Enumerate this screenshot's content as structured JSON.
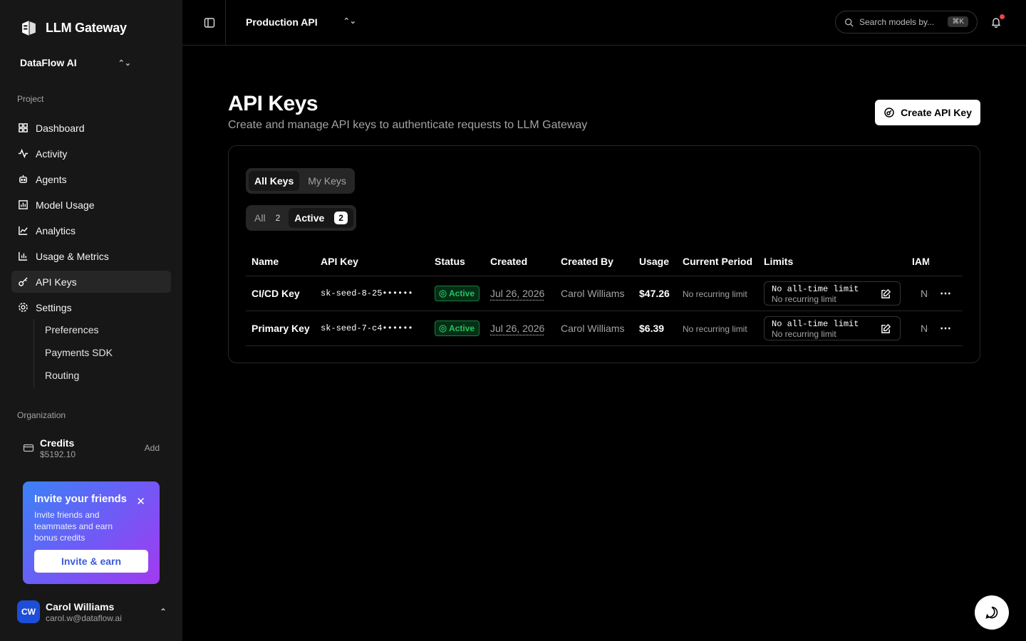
{
  "app": {
    "name": "LLM Gateway",
    "org": "DataFlow AI"
  },
  "sidebar": {
    "project_label": "Project",
    "items": [
      {
        "label": "Dashboard",
        "icon": "dashboard-icon"
      },
      {
        "label": "Activity",
        "icon": "activity-icon"
      },
      {
        "label": "Agents",
        "icon": "bot-icon"
      },
      {
        "label": "Model Usage",
        "icon": "bar-chart-icon"
      },
      {
        "label": "Analytics",
        "icon": "line-chart-icon"
      },
      {
        "label": "Usage & Metrics",
        "icon": "bar-chart-icon"
      },
      {
        "label": "API Keys",
        "icon": "key-icon",
        "active": true
      },
      {
        "label": "Settings",
        "icon": "gear-icon"
      }
    ],
    "sub_items": [
      "Preferences",
      "Payments SDK",
      "Routing"
    ],
    "org_label": "Organization",
    "credits": {
      "label": "Credits",
      "value": "$5192.10",
      "action": "Add"
    },
    "invite": {
      "title": "Invite your friends",
      "desc": "Invite friends and teammates and earn bonus credits",
      "button": "Invite & earn"
    },
    "user": {
      "initials": "CW",
      "name": "Carol Williams",
      "email": "carol.w@dataflow.ai"
    }
  },
  "topbar": {
    "project": "Production API",
    "search_placeholder": "Search models by...",
    "shortcut": "⌘K"
  },
  "main": {
    "title": "API Keys",
    "subtitle": "Create and manage API keys to authenticate requests to LLM Gateway",
    "create_button": "Create API Key",
    "tabs": [
      "All Keys",
      "My Keys"
    ],
    "filters": [
      {
        "label": "All",
        "count": "2"
      },
      {
        "label": "Active",
        "count": "2"
      }
    ],
    "columns": [
      "Name",
      "API Key",
      "Status",
      "Created",
      "Created By",
      "Usage",
      "Current Period",
      "Limits",
      "IAM"
    ],
    "rows": [
      {
        "name": "CI/CD Key",
        "key": "sk-seed-8-25••••••",
        "status": "Active",
        "created": "Jul 26, 2026",
        "created_by": "Carol Williams",
        "usage": "$47.26",
        "period": "No recurring limit",
        "limit1": "No all-time limit",
        "limit2": "No recurring limit",
        "iam": "No"
      },
      {
        "name": "Primary Key",
        "key": "sk-seed-7-c4••••••",
        "status": "Active",
        "created": "Jul 26, 2026",
        "created_by": "Carol Williams",
        "usage": "$6.39",
        "period": "No recurring limit",
        "limit1": "No all-time limit",
        "limit2": "No recurring limit",
        "iam": "No"
      }
    ]
  },
  "colors": {
    "accent_green": "#22c55e",
    "notification": "#ef4444",
    "avatar": "#1d4ed8"
  }
}
